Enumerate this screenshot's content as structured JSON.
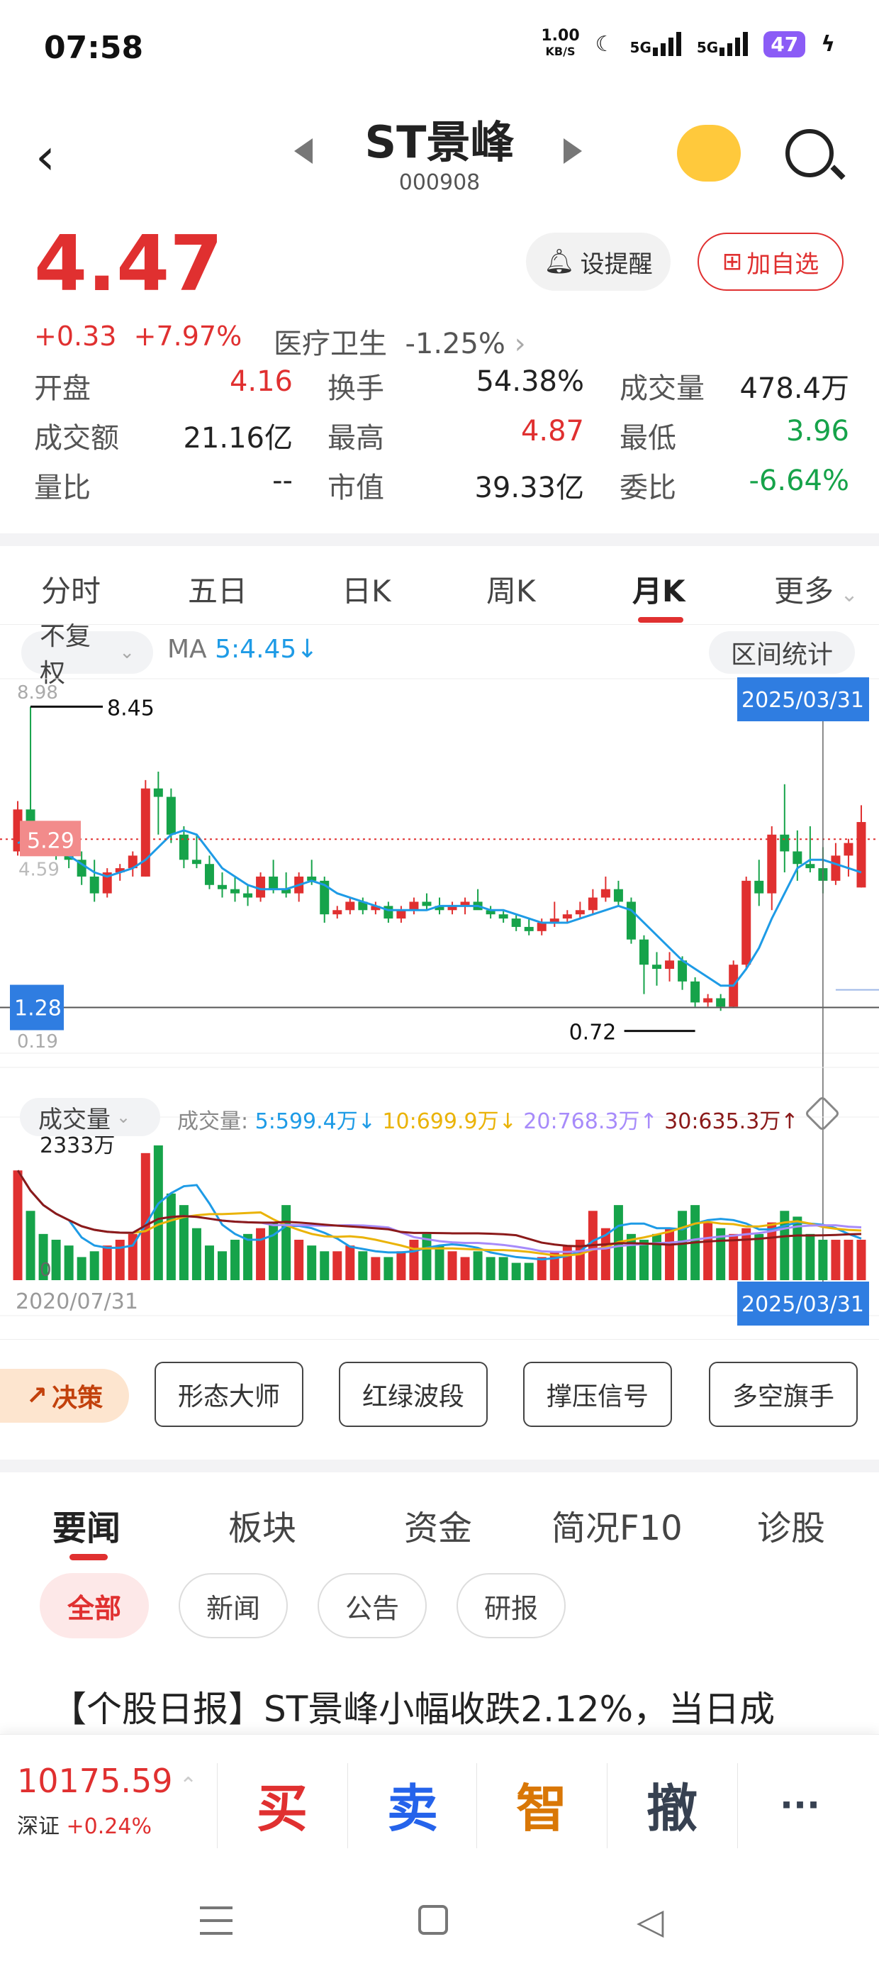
{
  "status": {
    "time": "07:58",
    "net_speed": "1.00",
    "net_unit": "KB/S",
    "sig1": "5G",
    "sig2": "5G",
    "battery": "47"
  },
  "header": {
    "name": "ST景峰",
    "code": "000908"
  },
  "quote": {
    "price": "4.47",
    "change": "+0.33",
    "change_pct": "+7.97%",
    "sector": "医疗卫生",
    "sector_pct": "-1.25%",
    "remind_label": "设提醒",
    "add_label": "加自选"
  },
  "stats": [
    {
      "label": "开盘",
      "value": "4.16",
      "color": "red"
    },
    {
      "label": "换手",
      "value": "54.38%",
      "color": "dark"
    },
    {
      "label": "成交量",
      "value": "478.4万",
      "color": "dark"
    },
    {
      "label": "成交额",
      "value": "21.16亿",
      "color": "dark"
    },
    {
      "label": "最高",
      "value": "4.87",
      "color": "red"
    },
    {
      "label": "最低",
      "value": "3.96",
      "color": "green"
    },
    {
      "label": "量比",
      "value": "--",
      "color": "dark"
    },
    {
      "label": "市值",
      "value": "39.33亿",
      "color": "dark"
    },
    {
      "label": "委比",
      "value": "-6.64%",
      "color": "green"
    }
  ],
  "period_tabs": [
    "分时",
    "五日",
    "日K",
    "周K",
    "月K",
    "更多"
  ],
  "active_period": "月K",
  "toolbar": {
    "adjust": "不复权",
    "ma_label": "MA",
    "ma_value": "5:4.45↓",
    "range_stats": "区间统计"
  },
  "chart_data": {
    "type": "candlestick",
    "period": "monthly",
    "start_date": "2020/07/31",
    "end_date": "2025/03/31",
    "price_axis": {
      "top": "8.98",
      "bottom": "0.19"
    },
    "labels": {
      "max": "8.45",
      "min": "0.72",
      "current": "5.29",
      "lower": "1.28",
      "side": "4.59"
    },
    "candles_ohlc": [
      [
        5.0,
        6.2,
        4.9,
        6.0
      ],
      [
        6.0,
        8.45,
        5.3,
        5.6
      ],
      [
        5.6,
        5.7,
        5.0,
        5.3
      ],
      [
        5.3,
        5.6,
        4.8,
        5.2
      ],
      [
        5.2,
        5.4,
        4.6,
        4.8
      ],
      [
        4.8,
        5.0,
        4.2,
        4.4
      ],
      [
        4.4,
        4.8,
        3.8,
        4.0
      ],
      [
        4.0,
        4.6,
        3.9,
        4.5
      ],
      [
        4.5,
        4.7,
        4.3,
        4.6
      ],
      [
        4.6,
        5.0,
        4.4,
        4.9
      ],
      [
        4.4,
        6.7,
        4.4,
        6.5
      ],
      [
        6.5,
        6.9,
        5.4,
        6.3
      ],
      [
        6.3,
        6.5,
        5.2,
        5.4
      ],
      [
        5.4,
        5.6,
        4.6,
        4.8
      ],
      [
        4.8,
        5.4,
        4.6,
        4.7
      ],
      [
        4.7,
        4.9,
        4.1,
        4.2
      ],
      [
        4.2,
        4.5,
        3.9,
        4.1
      ],
      [
        4.1,
        4.4,
        3.8,
        4.0
      ],
      [
        4.0,
        4.2,
        3.7,
        3.9
      ],
      [
        3.9,
        4.5,
        3.8,
        4.4
      ],
      [
        4.4,
        4.8,
        4.0,
        4.1
      ],
      [
        4.1,
        4.5,
        3.9,
        4.0
      ],
      [
        4.0,
        4.5,
        3.8,
        4.4
      ],
      [
        4.4,
        4.8,
        4.2,
        4.3
      ],
      [
        4.3,
        4.4,
        3.3,
        3.5
      ],
      [
        3.5,
        3.7,
        3.4,
        3.6
      ],
      [
        3.6,
        3.9,
        3.5,
        3.8
      ],
      [
        3.8,
        3.9,
        3.5,
        3.6
      ],
      [
        3.6,
        3.8,
        3.5,
        3.7
      ],
      [
        3.7,
        3.8,
        3.3,
        3.4
      ],
      [
        3.4,
        3.7,
        3.3,
        3.6
      ],
      [
        3.6,
        3.9,
        3.5,
        3.8
      ],
      [
        3.8,
        4.0,
        3.6,
        3.7
      ],
      [
        3.7,
        3.9,
        3.5,
        3.6
      ],
      [
        3.6,
        3.8,
        3.5,
        3.7
      ],
      [
        3.7,
        3.9,
        3.5,
        3.8
      ],
      [
        3.8,
        4.1,
        3.7,
        3.6
      ],
      [
        3.6,
        3.7,
        3.4,
        3.5
      ],
      [
        3.5,
        3.6,
        3.3,
        3.4
      ],
      [
        3.4,
        3.5,
        3.1,
        3.2
      ],
      [
        3.2,
        3.4,
        3.0,
        3.1
      ],
      [
        3.1,
        3.4,
        3.0,
        3.3
      ],
      [
        3.3,
        3.8,
        3.2,
        3.4
      ],
      [
        3.4,
        3.6,
        3.3,
        3.5
      ],
      [
        3.5,
        3.8,
        3.4,
        3.6
      ],
      [
        3.6,
        4.1,
        3.5,
        3.9
      ],
      [
        3.9,
        4.4,
        3.8,
        4.1
      ],
      [
        4.1,
        4.3,
        3.7,
        3.8
      ],
      [
        3.8,
        3.9,
        2.8,
        2.9
      ],
      [
        2.9,
        3.0,
        1.6,
        2.3
      ],
      [
        2.3,
        2.6,
        1.8,
        2.2
      ],
      [
        2.2,
        2.6,
        1.9,
        2.4
      ],
      [
        2.4,
        2.5,
        1.7,
        1.9
      ],
      [
        1.9,
        2.0,
        1.3,
        1.4
      ],
      [
        1.4,
        1.6,
        1.3,
        1.5
      ],
      [
        1.5,
        1.6,
        1.2,
        1.3
      ],
      [
        1.3,
        2.4,
        1.3,
        2.3
      ],
      [
        2.3,
        4.4,
        2.2,
        4.3
      ],
      [
        4.3,
        4.8,
        3.7,
        4.0
      ],
      [
        4.0,
        5.6,
        3.6,
        5.4
      ],
      [
        5.4,
        6.6,
        4.5,
        5.0
      ],
      [
        5.0,
        5.5,
        4.3,
        4.7
      ],
      [
        4.7,
        5.6,
        4.5,
        4.6
      ],
      [
        4.6,
        5.1,
        4.0,
        4.3
      ],
      [
        4.3,
        5.2,
        4.2,
        4.9
      ],
      [
        4.9,
        5.3,
        4.4,
        5.2
      ],
      [
        4.14,
        6.1,
        4.14,
        5.7
      ]
    ],
    "ma5_line": [
      5.2,
      5.3,
      5.2,
      5.0,
      4.9,
      4.7,
      4.5,
      4.4,
      4.5,
      4.6,
      4.8,
      5.1,
      5.4,
      5.5,
      5.4,
      5.0,
      4.6,
      4.4,
      4.2,
      4.1,
      4.1,
      4.1,
      4.2,
      4.3,
      4.2,
      4.0,
      3.9,
      3.8,
      3.7,
      3.6,
      3.6,
      3.6,
      3.6,
      3.7,
      3.7,
      3.7,
      3.7,
      3.6,
      3.6,
      3.5,
      3.4,
      3.3,
      3.3,
      3.3,
      3.4,
      3.5,
      3.6,
      3.7,
      3.6,
      3.3,
      3.0,
      2.7,
      2.4,
      2.2,
      2.0,
      1.8,
      1.8,
      2.2,
      2.7,
      3.4,
      4.0,
      4.6,
      4.8,
      4.8,
      4.7,
      4.6,
      4.5
    ],
    "volume_series": {
      "ma5": "5:599.4万↓",
      "ma10": "10:699.9万↓",
      "ma20": "20:768.3万↑",
      "ma30": "30:635.3万↑"
    },
    "volume_max_label": "2333万",
    "volume_min_label": "0",
    "volumes": [
      1900,
      1200,
      800,
      700,
      600,
      400,
      500,
      600,
      700,
      800,
      2200,
      2333,
      1500,
      1300,
      900,
      600,
      500,
      700,
      800,
      900,
      1000,
      1300,
      700,
      600,
      500,
      500,
      600,
      500,
      400,
      400,
      500,
      700,
      800,
      600,
      500,
      400,
      500,
      400,
      400,
      300,
      300,
      400,
      500,
      600,
      700,
      1200,
      900,
      1300,
      800,
      700,
      800,
      900,
      1200,
      1300,
      1000,
      900,
      800,
      900,
      800,
      1000,
      1200,
      1100,
      800,
      700,
      700,
      700,
      700
    ]
  },
  "volume_selector": "成交量",
  "volume_prefix": "成交量:",
  "feature": {
    "tag": "决策",
    "buttons": [
      "形态大师",
      "红绿波段",
      "撑压信号",
      "多空旗手"
    ]
  },
  "news_tabs": [
    "要闻",
    "板块",
    "资金",
    "简况F10",
    "诊股"
  ],
  "news_filters": [
    "全部",
    "新闻",
    "公告",
    "研报"
  ],
  "headline": "【个股日报】ST景峰小幅收跌2.12%，当日成",
  "bottom": {
    "index_value": "10175.59",
    "index_name": "深证",
    "index_pct": "+0.24%",
    "buy": "买",
    "sell": "卖",
    "smart": "智",
    "cancel": "撤",
    "more": "···"
  },
  "colors": {
    "up": "#e03030",
    "down": "#16a34a",
    "ma5": "#1e9be6",
    "ma10": "#eab308",
    "ma20": "#a78bfa",
    "ma30": "#8b1a1a",
    "date_tag": "#2f7de1"
  }
}
